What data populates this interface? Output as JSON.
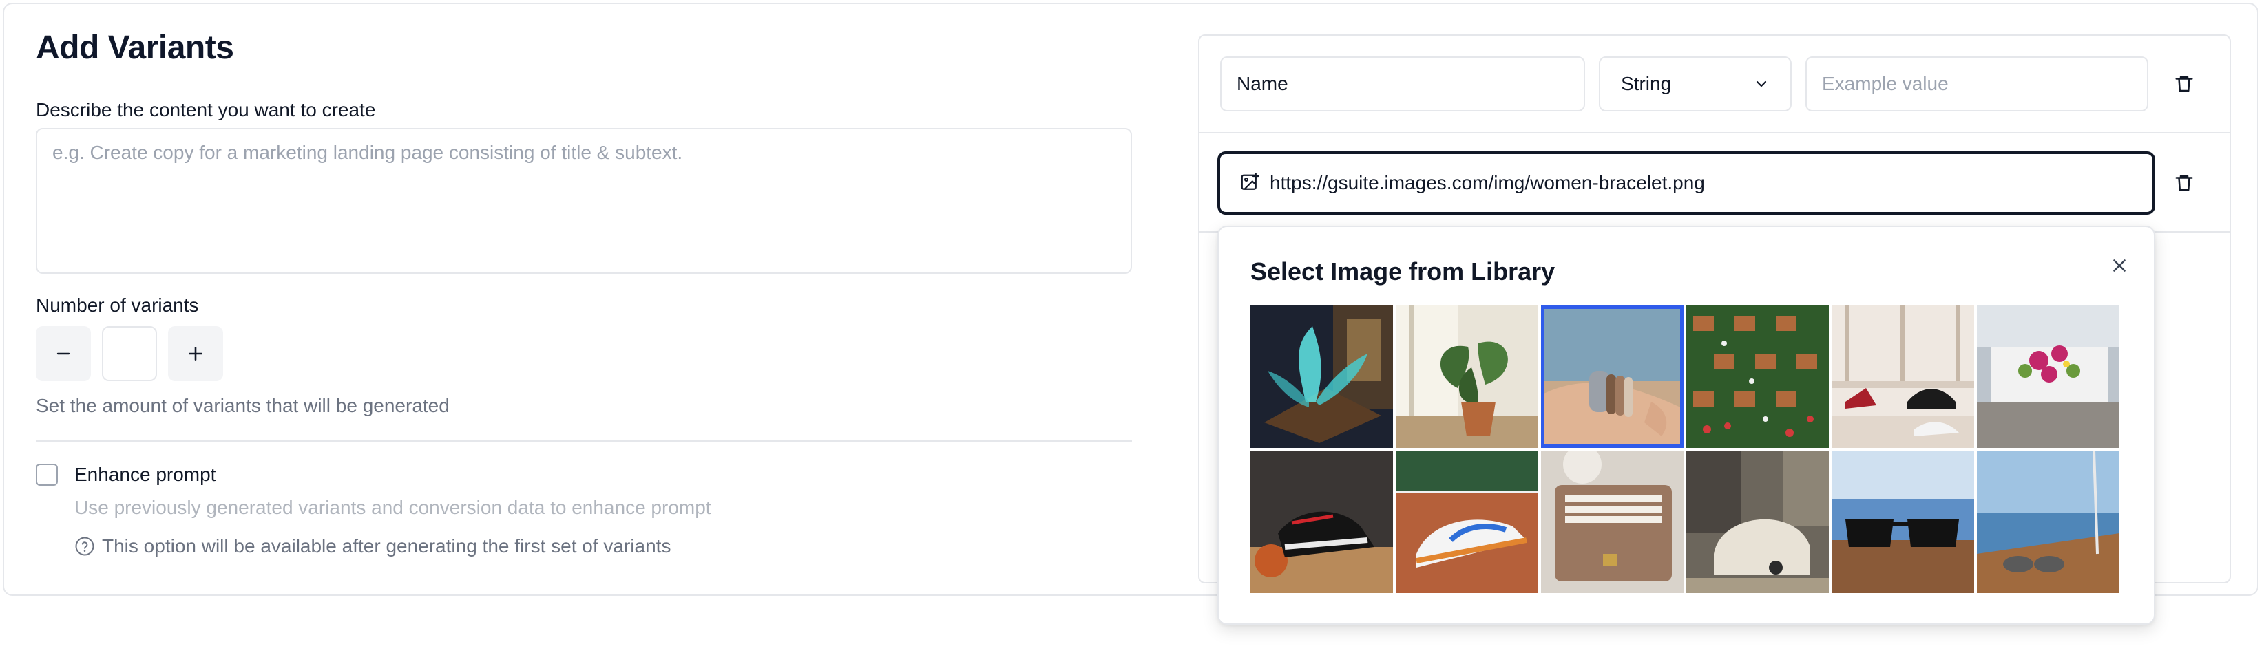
{
  "form": {
    "title": "Add Variants",
    "describe_label": "Describe the content you want to create",
    "describe_placeholder": "e.g. Create copy for a marketing landing page consisting of title & subtext.",
    "variants_label": "Number of variants",
    "minus_label": "−",
    "plus_label": "+",
    "variants_value": "",
    "variants_helper": "Set the amount of variants that will be generated",
    "enhance_label": "Enhance prompt",
    "enhance_checked": false,
    "enhance_description": "Use previously generated variants and conversion data to enhance prompt",
    "enhance_note": "This option will be available after generating the first set of variants"
  },
  "variables": {
    "row1": {
      "name_value": "Name",
      "type_value": "String",
      "example_placeholder": "Example value"
    },
    "row2": {
      "url_value": "https://gsuite.images.com/img/women-bracelet.png"
    }
  },
  "image_library": {
    "title": "Select Image from Library",
    "selected_index": 2,
    "images": [
      "glowing-plant-hologram",
      "potted-monstera-window",
      "woman-wrist-bracelet",
      "vertical-flower-wall",
      "shoes-on-shelf",
      "flower-planter-patio",
      "basketball-sneakers",
      "sneakers-on-clay-court",
      "leather-wallet",
      "living-room-chair",
      "sunglasses-on-deck",
      "sunglasses-on-yacht"
    ]
  },
  "colors": {
    "accent": "#2f5bea",
    "border": "#e5e7eb",
    "text": "#0f172a",
    "muted": "#6b7280"
  }
}
